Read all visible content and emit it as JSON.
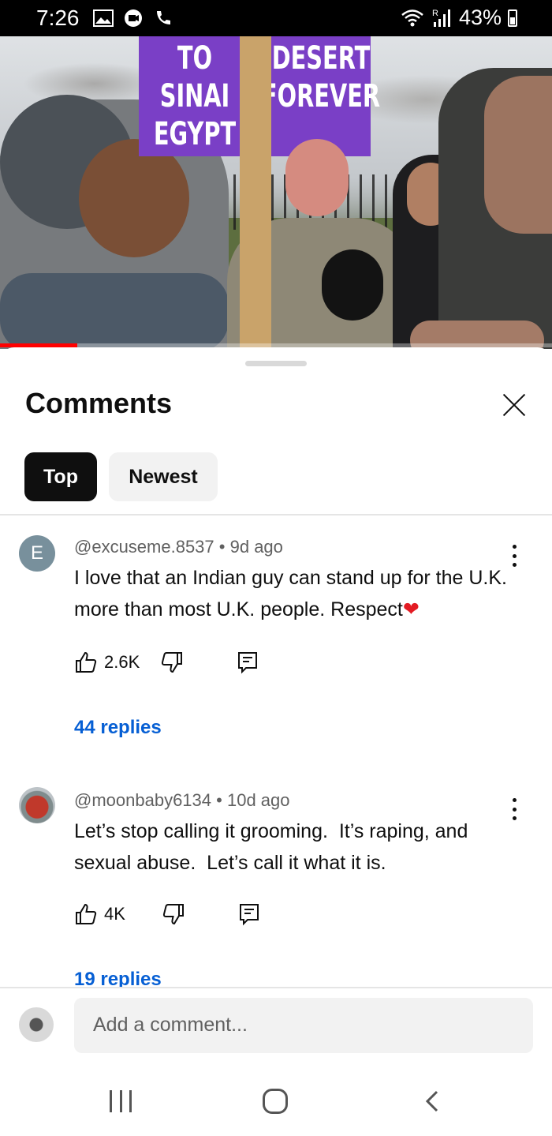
{
  "status_bar": {
    "time": "7:26",
    "signal_label": "R",
    "battery": "43%"
  },
  "video": {
    "sign_left": "TO SINAI\nEGYPT",
    "sign_right": "DESERT\nFOREVER",
    "progress": 0.14,
    "accent_color": "#ff0000"
  },
  "comments_panel": {
    "title": "Comments",
    "tabs": [
      {
        "label": "Top",
        "selected": true
      },
      {
        "label": "Newest",
        "selected": false
      }
    ],
    "comments": [
      {
        "avatar_letter": "E",
        "author": "@excuseme.8537",
        "age": "9d ago",
        "text": "I love that an Indian guy can stand up for the U.K. more than most U.K. people. Respect",
        "likes": "2.6K",
        "replies": "44 replies"
      },
      {
        "author": "@moonbaby6134",
        "age": "10d ago",
        "text": "Let’s stop calling it grooming.  It’s raping, and sexual abuse.  Let’s call it what it is.",
        "likes": "4K",
        "replies": "19 replies"
      }
    ],
    "add_comment_placeholder": "Add a comment...",
    "link_color": "#065fd4"
  },
  "icons": {
    "like": "thumbs-up-icon",
    "dislike": "thumbs-down-icon",
    "reply": "reply-icon",
    "more": "more-vert-icon",
    "close": "close-icon",
    "heart": "heart-icon"
  }
}
